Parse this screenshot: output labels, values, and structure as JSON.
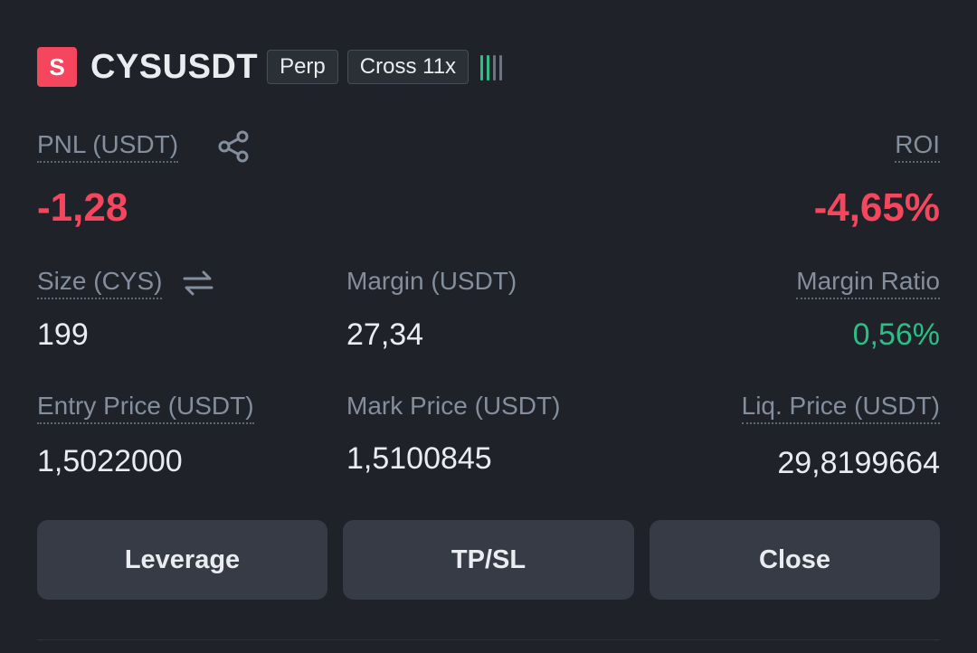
{
  "header": {
    "side_badge": "S",
    "symbol": "CYSUSDT",
    "type_tag": "Perp",
    "margin_tag": "Cross 11x",
    "signal_icon": "risk-level-bars",
    "signal_level": 4,
    "signal_colors": [
      "#2ebd85",
      "#2ebd85",
      "#848e9c",
      "#848e9c"
    ]
  },
  "pnl": {
    "label": "PNL (USDT)",
    "value": "-1,28",
    "share_icon": "share-icon"
  },
  "roi": {
    "label": "ROI",
    "value": "-4,65%"
  },
  "size": {
    "label": "Size (CYS)",
    "value": "199",
    "switch_icon": "swap-arrows-icon"
  },
  "margin": {
    "label": "Margin (USDT)",
    "value": "27,34"
  },
  "margin_ratio": {
    "label": "Margin Ratio",
    "value": "0,56%"
  },
  "entry_price": {
    "label": "Entry Price (USDT)",
    "value": "1,5022000"
  },
  "mark_price": {
    "label": "Mark Price (USDT)",
    "value": "1,5100845"
  },
  "liq_price": {
    "label": "Liq. Price (USDT)",
    "value": "29,8199664"
  },
  "buttons": {
    "leverage": "Leverage",
    "tpsl": "TP/SL",
    "close": "Close"
  },
  "colors": {
    "background": "#1f2229",
    "negative": "#f6465d",
    "positive": "#2ebd85",
    "muted": "#848e9c",
    "button_bg": "#363b45"
  }
}
